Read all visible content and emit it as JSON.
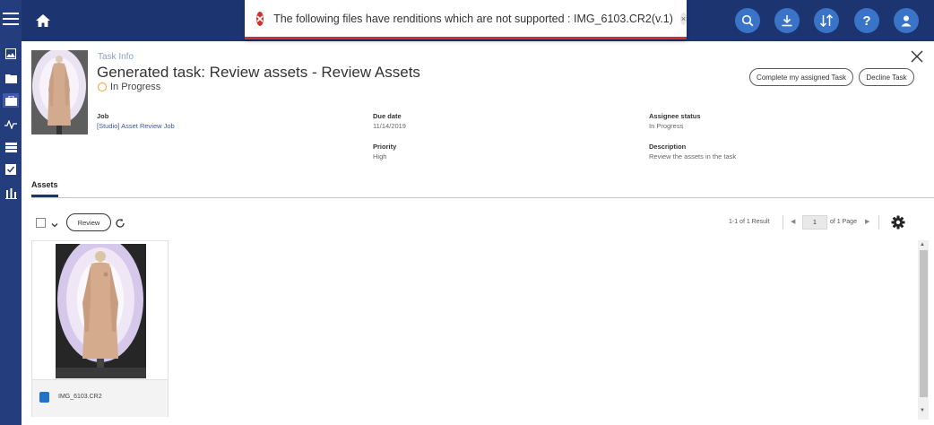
{
  "toast": {
    "message": "The following files have renditions which are not supported : IMG_6103.CR2(v.1)",
    "close_glyph": "×"
  },
  "header": {
    "section_label": "Task Info",
    "title": "Generated task: Review assets - Review Assets",
    "status": "In Progress",
    "complete_button": "Complete my assigned Task",
    "decline_button": "Decline Task"
  },
  "details": {
    "job_label": "Job",
    "job_value": "[Studio] Asset Review Job",
    "due_label": "Due date",
    "due_value": "11/14/2019",
    "assignee_label": "Assignee status",
    "assignee_value": "In Progress",
    "priority_label": "Priority",
    "priority_value": "High",
    "description_label": "Description",
    "description_value": "Review the assets in the task"
  },
  "tabs": [
    {
      "label": "Assets"
    }
  ],
  "toolbar": {
    "review_button": "Review",
    "results_text": "1-1 of 1 Result",
    "page_value": "1",
    "of_page_text": "of 1 Page"
  },
  "assets": [
    {
      "filename": "IMG_6103.CR2"
    }
  ],
  "icons": {
    "rail": [
      "menu-icon",
      "image-icon",
      "folder-icon",
      "briefcase-icon",
      "activity-icon",
      "stack-icon",
      "checklist-icon",
      "bar-chart-icon"
    ],
    "top": [
      "home-icon",
      "search-icon",
      "download-icon",
      "sort-icon",
      "help-icon",
      "user-icon"
    ]
  },
  "colors": {
    "rail": "#243d7c",
    "topbar": "#1c3470",
    "accent": "#3a74c9",
    "error": "#d0312d",
    "status_pending": "#f0a030"
  }
}
